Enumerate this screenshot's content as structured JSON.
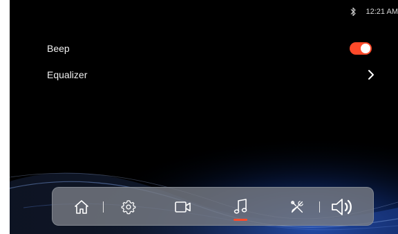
{
  "status_bar": {
    "bluetooth_icon": "bluetooth-icon",
    "time": "12:21 AM"
  },
  "settings": {
    "beep": {
      "label": "Beep",
      "enabled": true,
      "toggle_color": "#ff4a2a"
    },
    "equalizer": {
      "label": "Equalizer",
      "icon": "chevron-right-icon"
    }
  },
  "dock": {
    "items": [
      {
        "icon": "home-icon",
        "active": false
      },
      {
        "icon": "gear-icon",
        "active": false
      },
      {
        "icon": "video-camera-icon",
        "active": false
      },
      {
        "icon": "music-note-icon",
        "active": true
      },
      {
        "icon": "tools-icon",
        "active": false
      },
      {
        "icon": "volume-icon",
        "active": false
      }
    ],
    "active_indicator_color": "#ff4a2a"
  }
}
